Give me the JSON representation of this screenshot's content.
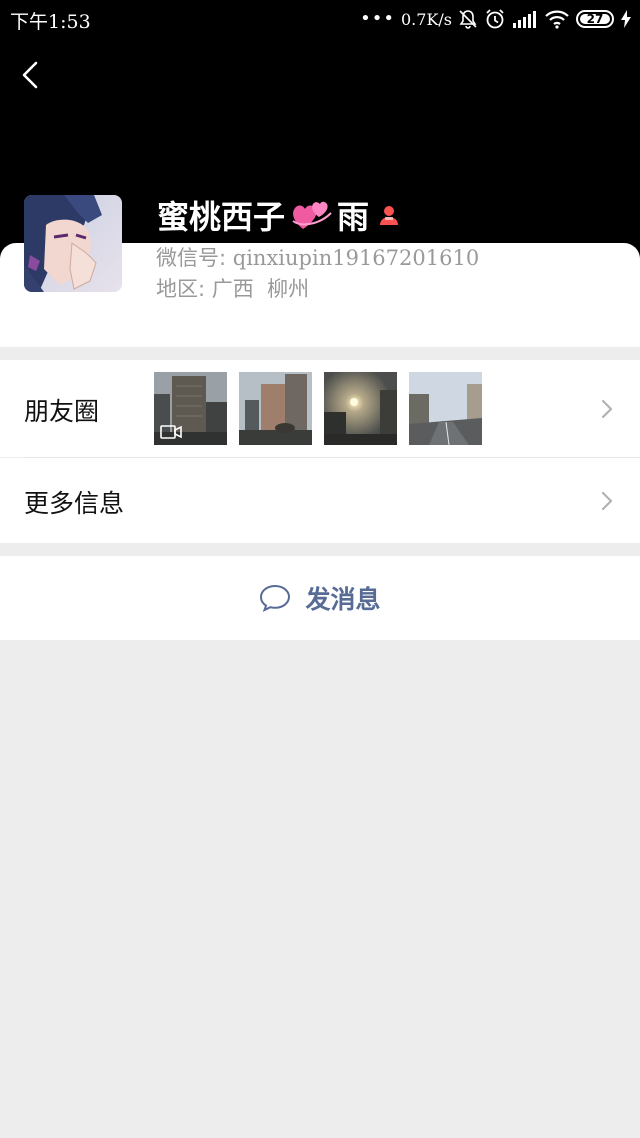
{
  "status_bar": {
    "time": "下午1:53",
    "network_speed": "0.7K/s",
    "battery_level": "27",
    "icons": [
      "more-dots-icon",
      "mute-bell-icon",
      "alarm-icon",
      "signal-icon",
      "wifi-icon",
      "battery-icon",
      "charging-icon"
    ]
  },
  "header": {
    "back_icon": "back-arrow-icon"
  },
  "profile": {
    "nickname_part1": "蜜桃西子",
    "nickname_part2": "雨",
    "emoji": "two-hearts-emoji",
    "gender_icon": "female-icon",
    "wechat_id_label": "微信号:",
    "wechat_id_value": "qinxiupin19167201610",
    "region_label": "地区:",
    "region_value": "广西  柳州"
  },
  "moments": {
    "label": "朋友圈",
    "thumb_count": 4,
    "first_thumb_is_video": true
  },
  "more_info": {
    "label": "更多信息"
  },
  "send": {
    "label": "发消息",
    "icon": "chat-bubble-icon"
  },
  "colors": {
    "header_bg": "#000000",
    "page_bg": "#ededed",
    "link_blue": "#576b95",
    "secondary_text": "#999999",
    "female_icon": "#fa5151"
  }
}
